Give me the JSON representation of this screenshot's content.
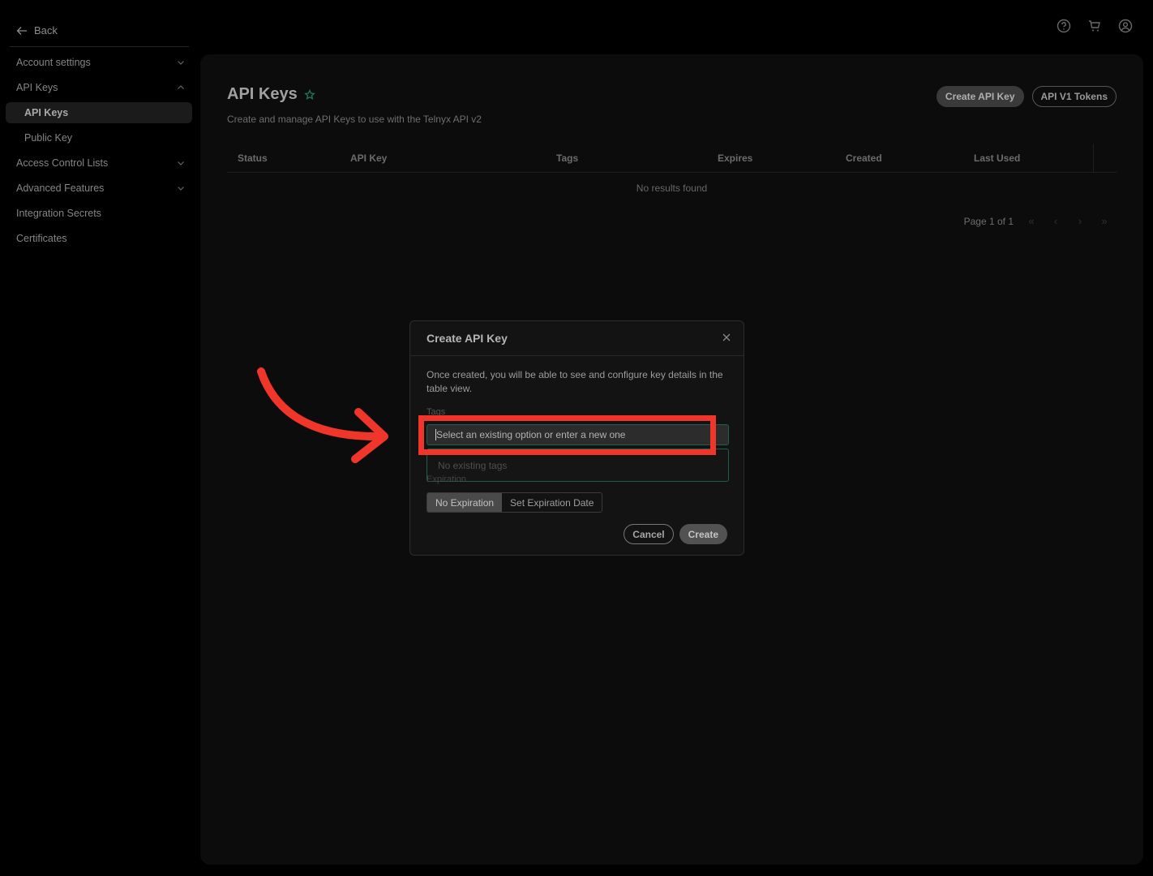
{
  "header": {
    "icons": [
      "help-icon",
      "cart-icon",
      "account-icon"
    ]
  },
  "sidebar": {
    "back_label": "Back",
    "items": [
      {
        "label": "Account settings",
        "chevron": "down"
      },
      {
        "label": "API Keys",
        "chevron": "up"
      },
      {
        "label": "API Keys",
        "active": true
      },
      {
        "label": "Public Key"
      },
      {
        "label": "Access Control Lists",
        "chevron": "down"
      },
      {
        "label": "Advanced Features",
        "chevron": "down"
      },
      {
        "label": "Integration Secrets"
      },
      {
        "label": "Certificates"
      }
    ]
  },
  "main": {
    "title": "API Keys",
    "subtitle": "Create and manage API Keys to use with the Telnyx API v2",
    "buttons": {
      "create": "Create API Key",
      "v1_tokens": "API V1 Tokens"
    },
    "table": {
      "columns": [
        "Status",
        "API Key",
        "Tags",
        "Expires",
        "Created",
        "Last Used"
      ],
      "empty_text": "No results found"
    },
    "pagination": {
      "label": "Page 1 of 1"
    }
  },
  "modal": {
    "title": "Create API Key",
    "description": "Once created, you will be able to see and configure key details in the table view.",
    "tags_label": "Tags",
    "tags_placeholder": "Select an existing option or enter a new one",
    "tags_empty": "No existing tags",
    "expiration_label": "Expiration",
    "expiration_options": [
      "No Expiration",
      "Set Expiration Date"
    ],
    "selected_expiration": "No Expiration",
    "cancel_label": "Cancel",
    "create_label": "Create"
  },
  "annotation": {
    "highlight_color": "#f0362a",
    "accent_color": "#1d5e4c"
  }
}
